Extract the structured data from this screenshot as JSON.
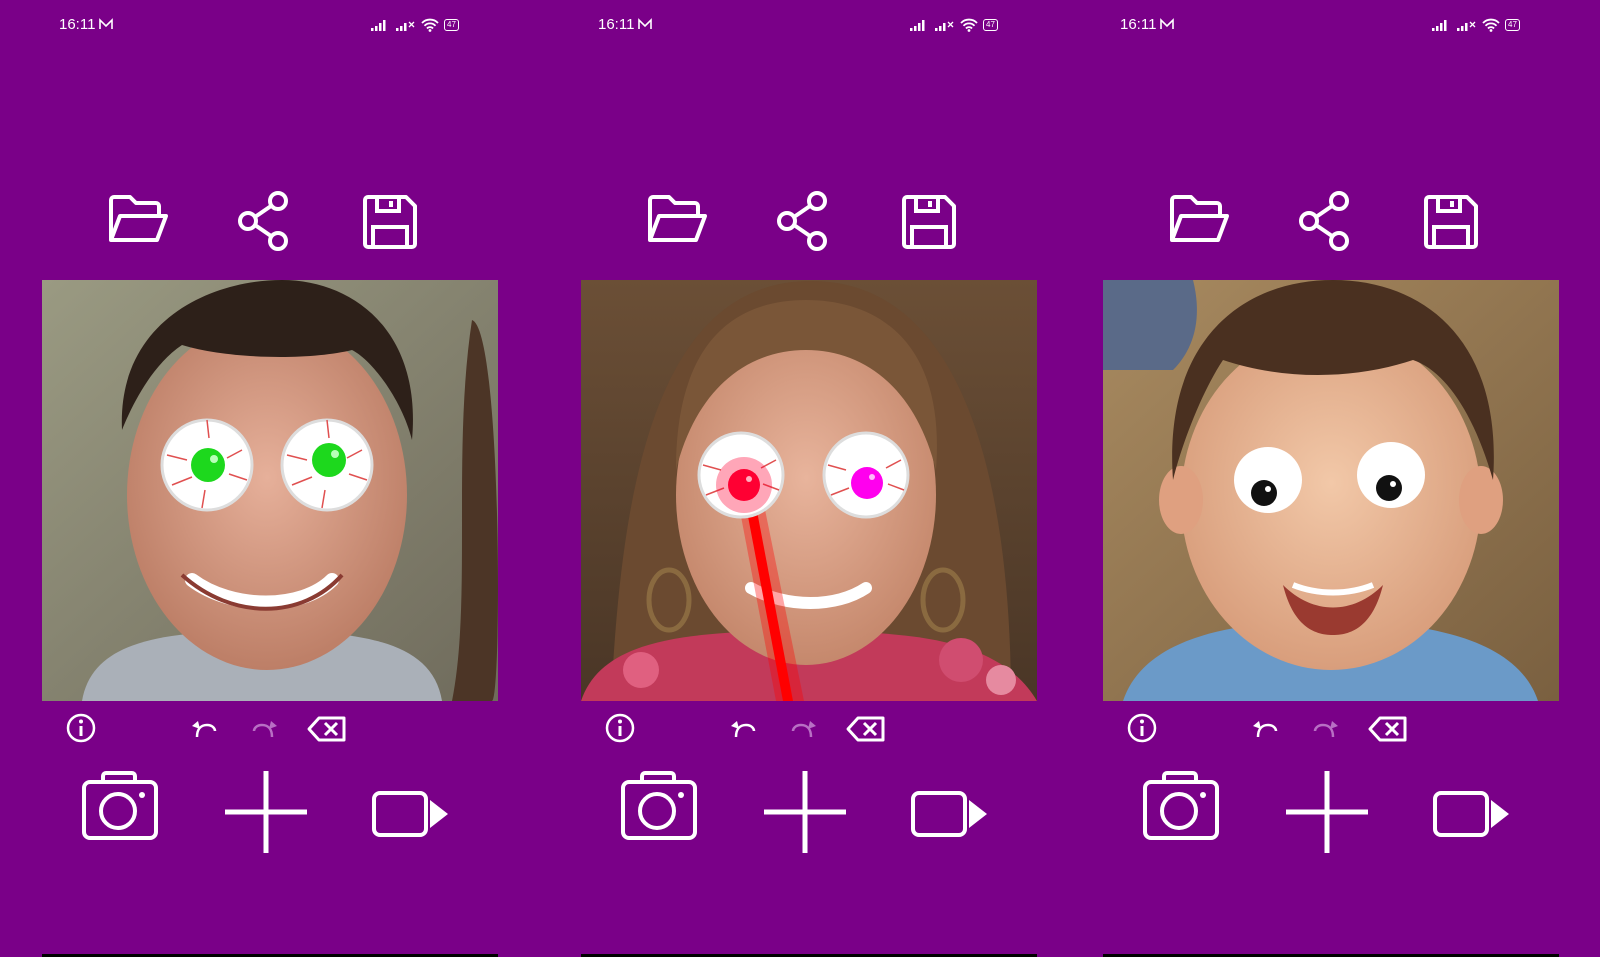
{
  "status_bar": {
    "time": "16:11",
    "battery": "47"
  },
  "screens": [
    {
      "name": "screen-green-eyes",
      "eye_iris_color": "#1dd81d",
      "eye_style": "bloodshot"
    },
    {
      "name": "screen-laser-eyes",
      "eye_iris_color_left": "#ff0033",
      "eye_iris_color_right": "#ff00ee",
      "laser_color": "#ff0000",
      "eye_style": "bloodshot"
    },
    {
      "name": "screen-cartoon-eyes",
      "eye_iris_color": "#111111",
      "eye_style": "cartoon"
    }
  ],
  "toolbar": {
    "icons": [
      "folder-open-icon",
      "share-icon",
      "save-icon"
    ]
  },
  "edit_bar": {
    "icons": [
      "info-icon",
      "undo-icon",
      "redo-icon",
      "clear-icon"
    ]
  },
  "bottom_bar": {
    "icons": [
      "camera-icon",
      "add-icon",
      "video-icon"
    ]
  },
  "colors": {
    "background": "#7a0088",
    "foreground": "#ffffff",
    "disabled": "#b86fc4"
  }
}
